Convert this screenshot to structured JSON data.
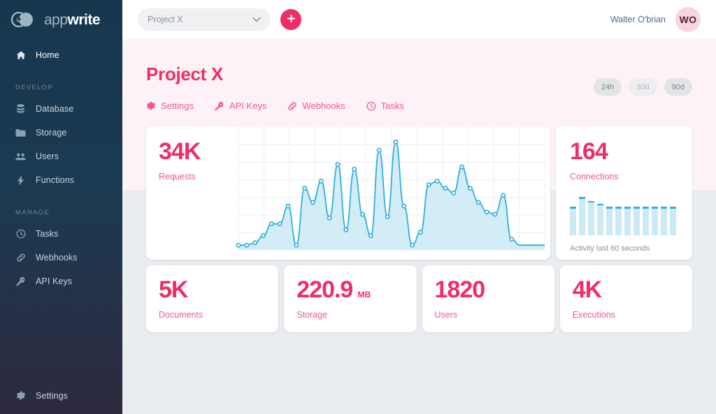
{
  "brand": {
    "logo_light": "app",
    "logo_bold": "write",
    "accent": "#f02e65",
    "accent_soft": "#f25a81",
    "sidebar_top": "#17374f",
    "sidebar_bottom": "#2d2a3f",
    "chart_line": "#31b0dd",
    "chart_fill": "#cbeaf5"
  },
  "sidebar": {
    "home": {
      "label": "Home",
      "icon": "home-icon"
    },
    "sections": [
      {
        "title": "DEVELOP",
        "items": [
          {
            "label": "Database",
            "icon": "database-icon"
          },
          {
            "label": "Storage",
            "icon": "folder-icon"
          },
          {
            "label": "Users",
            "icon": "users-icon"
          },
          {
            "label": "Functions",
            "icon": "bolt-icon"
          }
        ]
      },
      {
        "title": "MANAGE",
        "items": [
          {
            "label": "Tasks",
            "icon": "clock-icon"
          },
          {
            "label": "Webhooks",
            "icon": "link-icon"
          },
          {
            "label": "API Keys",
            "icon": "key-icon"
          }
        ]
      }
    ],
    "bottom": {
      "label": "Settings",
      "icon": "gear-icon"
    }
  },
  "topbar": {
    "project_select": {
      "value": "Project X",
      "icon": "chevron-down-icon"
    },
    "add_button": {
      "icon": "plus-icon",
      "label": "+"
    },
    "user_name": "Walter O'brian",
    "avatar_initials": "WO"
  },
  "page": {
    "title": "Project X",
    "tabs": [
      {
        "label": "Settings",
        "icon": "gear-icon"
      },
      {
        "label": "API Keys",
        "icon": "key-icon"
      },
      {
        "label": "Webhooks",
        "icon": "link-icon"
      },
      {
        "label": "Tasks",
        "icon": "clock-icon"
      }
    ],
    "ranges": [
      {
        "label": "24h",
        "selected": true
      },
      {
        "label": "30d",
        "selected": false
      },
      {
        "label": "90d",
        "selected": true
      }
    ]
  },
  "cards": {
    "requests": {
      "value": "34K",
      "label": "Requests"
    },
    "connections": {
      "value": "164",
      "label": "Connections",
      "note": "Activity last 60 seconds"
    },
    "documents": {
      "value": "5K",
      "label": "Documents",
      "unit": ""
    },
    "storage": {
      "value": "220.9",
      "label": "Storage",
      "unit": "MB"
    },
    "users": {
      "value": "1820",
      "label": "Users",
      "unit": ""
    },
    "executions": {
      "value": "4K",
      "label": "Executions",
      "unit": ""
    }
  },
  "chart_data": [
    {
      "type": "area",
      "title": "Requests",
      "xlabel": "",
      "ylabel": "",
      "grid": true,
      "ylim": [
        0,
        100
      ],
      "x": [
        0,
        1,
        2,
        3,
        4,
        5,
        6,
        7,
        8,
        9,
        10,
        11,
        12,
        13,
        14,
        15,
        16,
        17,
        18,
        19,
        20,
        21,
        22,
        23,
        24,
        25,
        26,
        27,
        28,
        29,
        30,
        31,
        32,
        33,
        34,
        35,
        36,
        37
      ],
      "values": [
        4,
        4,
        6,
        12,
        22,
        22,
        37,
        4,
        52,
        40,
        58,
        27,
        72,
        17,
        68,
        30,
        12,
        84,
        28,
        91,
        37,
        4,
        15,
        55,
        58,
        52,
        48,
        70,
        52,
        40,
        32,
        30,
        46,
        9,
        4,
        4,
        4,
        4
      ],
      "series": [
        {
          "name": "Requests",
          "values": [
            4,
            4,
            6,
            12,
            22,
            22,
            37,
            4,
            52,
            40,
            58,
            27,
            72,
            17,
            68,
            30,
            12,
            84,
            28,
            91,
            37,
            4,
            15,
            55,
            58,
            52,
            48,
            70,
            52,
            40,
            32,
            30,
            46,
            9,
            4,
            4,
            4,
            4
          ]
        }
      ]
    },
    {
      "type": "bar",
      "title": "Connections",
      "subtitle": "Activity last 60 seconds",
      "categories": [
        "1",
        "2",
        "3",
        "4",
        "5",
        "6",
        "7",
        "8",
        "9",
        "10",
        "11",
        "12"
      ],
      "values": [
        74,
        100,
        90,
        82,
        74,
        74,
        74,
        74,
        74,
        74,
        74,
        74
      ],
      "ylim": [
        0,
        100
      ],
      "grid": false
    }
  ]
}
